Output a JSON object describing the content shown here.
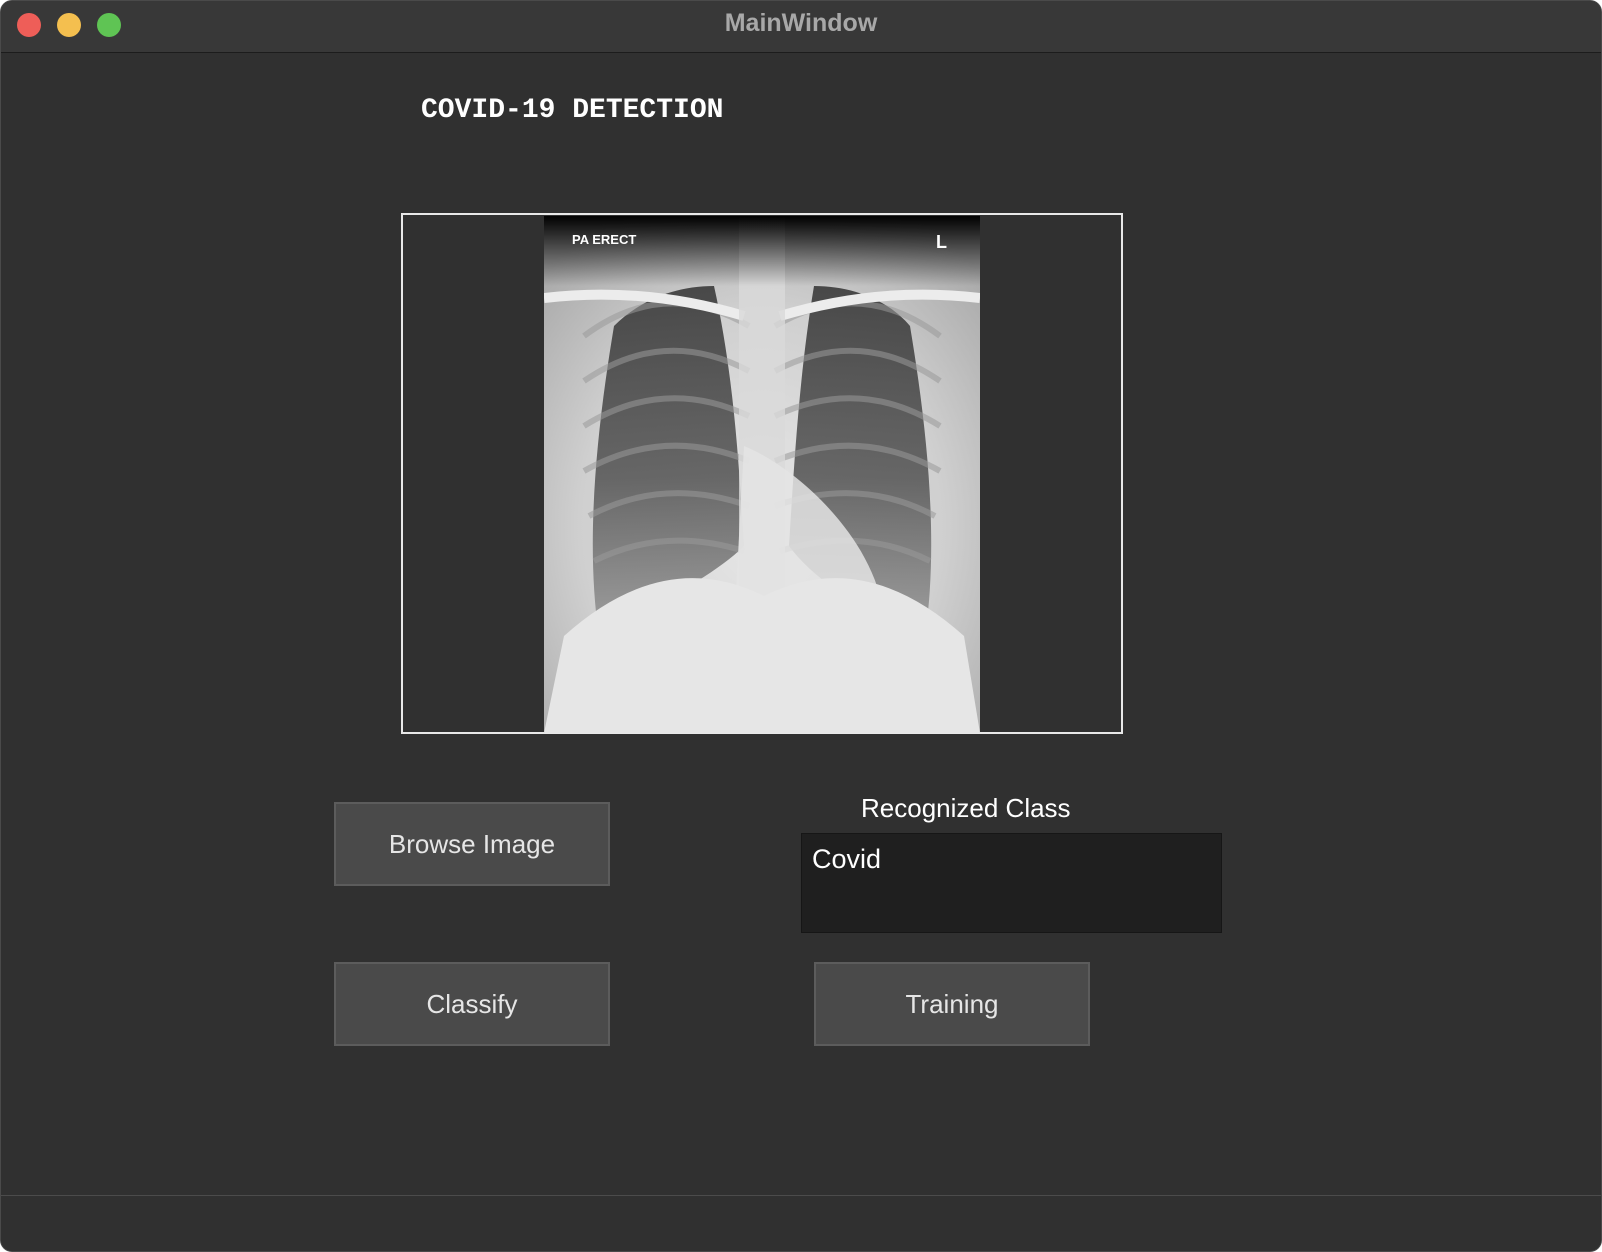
{
  "window": {
    "title": "MainWindow"
  },
  "header": {
    "title": "COVID-19 DETECTION"
  },
  "image_preview": {
    "overlay_top_left": "PA ERECT",
    "overlay_top_right": "L"
  },
  "actions": {
    "browse_label": "Browse Image",
    "classify_label": "Classify",
    "training_label": "Training"
  },
  "result": {
    "label": "Recognized Class",
    "value": "Covid"
  },
  "colors": {
    "background": "#303030",
    "button": "#4a4a4a",
    "result_box": "#1f1f1f",
    "close": "#ee5e58",
    "minimize": "#f4bf4f",
    "maximize": "#5fc454"
  }
}
